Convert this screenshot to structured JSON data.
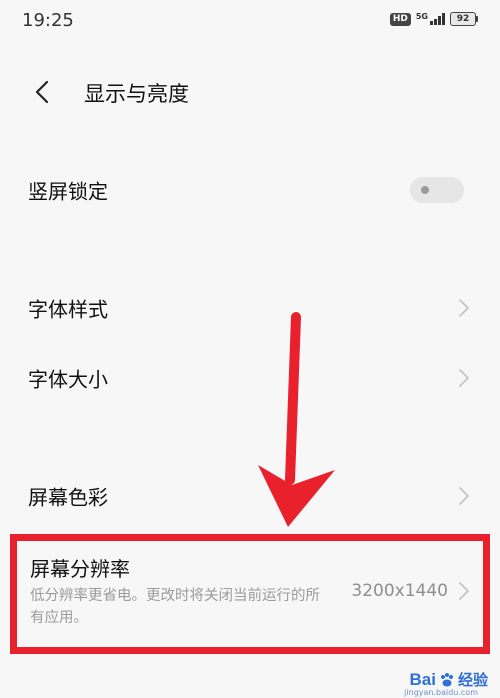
{
  "status_bar": {
    "time": "19:25",
    "hd_label": "HD",
    "network_label": "5G",
    "battery_level": "92"
  },
  "header": {
    "title": "显示与亮度"
  },
  "settings": {
    "portrait_lock": {
      "label": "竖屏锁定",
      "enabled": false
    },
    "font_style": {
      "label": "字体样式"
    },
    "font_size": {
      "label": "字体大小"
    },
    "screen_color": {
      "label": "屏幕色彩"
    },
    "screen_resolution": {
      "label": "屏幕分辨率",
      "description": "低分辨率更省电。更改时将关闭当前运行的所有应用。",
      "value": "3200x1440"
    }
  },
  "annotation": {
    "highlight_color": "#e8212c"
  },
  "watermark": {
    "logo": "Bai",
    "text": "经验",
    "sub": "jingyan.baidu.com"
  },
  "colors": {
    "background": "#f7f7f7",
    "text_primary": "#111111",
    "text_secondary": "#9b9b9b",
    "toggle_off": "#e6e6e6"
  }
}
